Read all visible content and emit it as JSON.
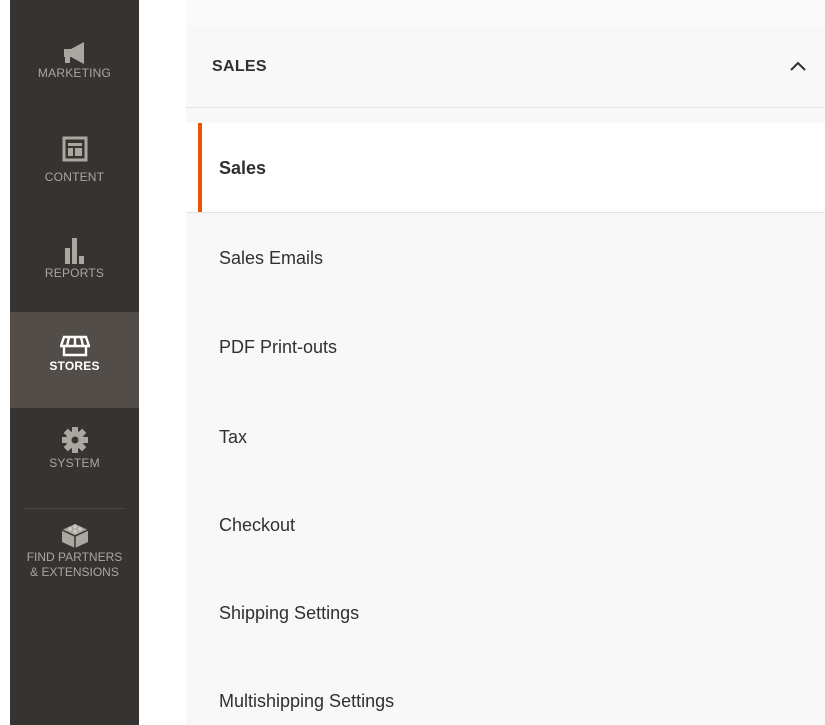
{
  "sidebar": {
    "items": [
      {
        "label": "MARKETING",
        "icon": "megaphone-icon"
      },
      {
        "label": "CONTENT",
        "icon": "layout-icon"
      },
      {
        "label": "REPORTS",
        "icon": "bar-chart-icon"
      },
      {
        "label": "STORES",
        "icon": "storefront-icon",
        "active": true
      },
      {
        "label": "SYSTEM",
        "icon": "gear-icon"
      },
      {
        "label_line1": "FIND PARTNERS",
        "label_line2": "& EXTENSIONS",
        "icon": "blocks-icon"
      }
    ]
  },
  "section": {
    "title": "SALES",
    "chevron_icon": "chevron-up-icon"
  },
  "menu": {
    "items": [
      {
        "label": "Sales",
        "active": true
      },
      {
        "label": "Sales Emails"
      },
      {
        "label": "PDF Print-outs"
      },
      {
        "label": "Tax"
      },
      {
        "label": "Checkout"
      },
      {
        "label": "Shipping Settings"
      },
      {
        "label": "Multishipping Settings"
      }
    ]
  },
  "colors": {
    "sidebar_bg": "#373330",
    "sidebar_active_bg": "#524d49",
    "accent": "#eb5202",
    "panel_bg": "#f8f8f8"
  }
}
